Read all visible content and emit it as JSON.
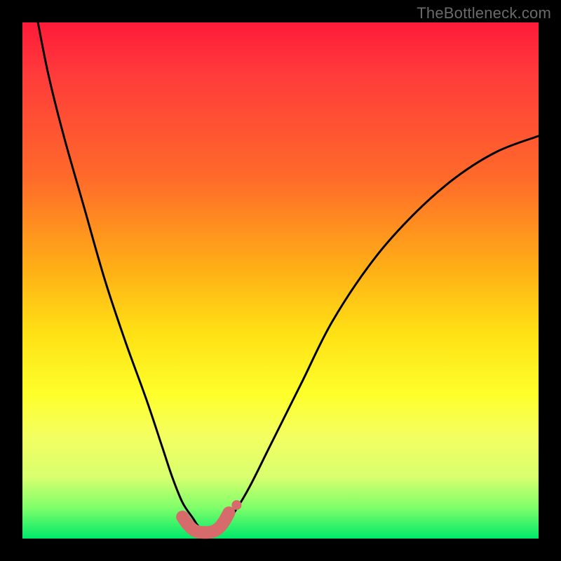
{
  "watermark": "TheBottleneck.com",
  "colors": {
    "curve": "#000000",
    "marker": "#d76a6a",
    "marker_fill": "#d76a6a",
    "frame": "#000000"
  },
  "chart_data": {
    "type": "line",
    "title": "",
    "xlabel": "",
    "ylabel": "",
    "xlim": [
      0,
      100
    ],
    "ylim": [
      0,
      100
    ],
    "grid": false,
    "legend": false,
    "series": [
      {
        "name": "bottleneck-curve",
        "x": [
          3,
          5,
          8,
          12,
          16,
          20,
          24,
          27,
          29,
          31,
          33,
          34,
          35,
          36,
          37,
          38,
          39,
          41,
          44,
          48,
          54,
          60,
          68,
          76,
          84,
          92,
          100
        ],
        "y": [
          100,
          90,
          78,
          64,
          50,
          38,
          27,
          18,
          12,
          7,
          4,
          2.5,
          1.5,
          1.2,
          1.2,
          1.5,
          2.5,
          5,
          10,
          18,
          30,
          42,
          54,
          63,
          70,
          75,
          78
        ]
      }
    ],
    "markers": {
      "name": "highlight-band",
      "x": [
        31,
        32,
        33,
        34,
        35,
        36,
        37,
        38,
        39,
        40
      ],
      "y": [
        4.2,
        2.8,
        1.8,
        1.3,
        1.2,
        1.2,
        1.4,
        2.0,
        3.2,
        5.0
      ]
    }
  }
}
